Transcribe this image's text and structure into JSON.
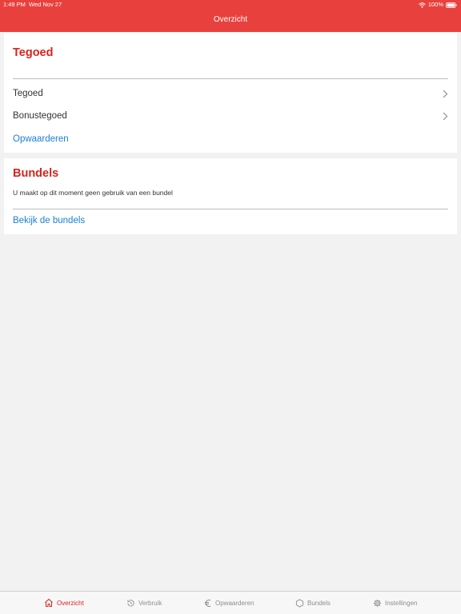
{
  "status_bar": {
    "time": "1:49 PM",
    "date": "Wed Nov 27",
    "battery": "100%",
    "wifi_icon": "wifi-icon",
    "battery_icon": "battery-icon"
  },
  "nav": {
    "title": "Overzicht"
  },
  "tegoed_card": {
    "title": "Tegoed",
    "rows": [
      {
        "label": "Tegoed",
        "icon": "chevron-right-icon"
      },
      {
        "label": "Bonustegoed",
        "icon": "chevron-right-icon"
      }
    ],
    "link": "Opwaarderen"
  },
  "bundels_card": {
    "title": "Bundels",
    "info": "U maakt op dit moment geen gebruik van een bundel",
    "link": "Bekijk de bundels"
  },
  "tab_bar": {
    "active": "Overzicht",
    "tabs": [
      {
        "label": "Overzicht",
        "icon": "home-icon"
      },
      {
        "label": "Verbruik",
        "icon": "history-icon"
      },
      {
        "label": "Opwaarderen",
        "icon": "euro-icon"
      },
      {
        "label": "Bundels",
        "icon": "hexagon-icon"
      },
      {
        "label": "Instellingen",
        "icon": "gear-icon"
      }
    ]
  },
  "colors": {
    "header": "#e8413d",
    "title_red": "#d8231e",
    "link_blue": "#1a7fd4",
    "background": "#f2f2f2",
    "tab_inactive": "#8e8e8e"
  }
}
